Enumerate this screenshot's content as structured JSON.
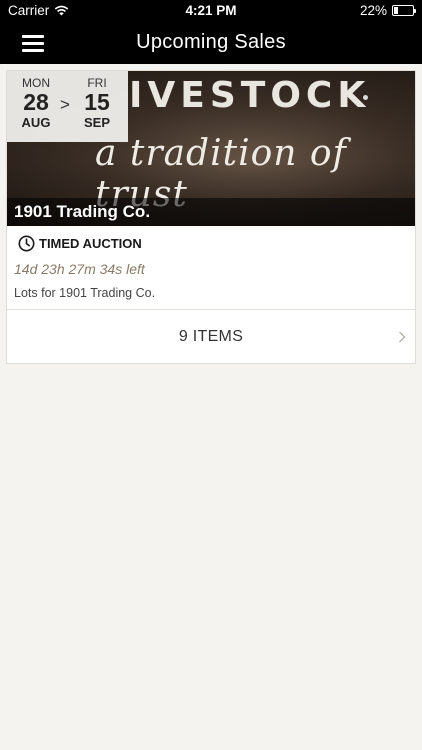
{
  "status_bar": {
    "carrier": "Carrier",
    "time": "4:21 PM",
    "battery_percent": "22%",
    "battery_level": 0.22,
    "wifi_icon": "wifi-icon",
    "battery_icon": "battery-icon"
  },
  "navbar": {
    "title": "Upcoming Sales",
    "menu_icon": "hamburger-menu-icon"
  },
  "sale": {
    "banner_word": "IVESTOCK",
    "banner_tagline": "a tradition of trust",
    "name": "1901 Trading Co.",
    "start": {
      "day": "MON",
      "date": "28",
      "month": "AUG"
    },
    "separator": ">",
    "end": {
      "day": "FRI",
      "date": "15",
      "month": "SEP"
    },
    "type": "TIMED AUCTION",
    "countdown": "14d 23h 27m 34s left",
    "lots_description": "Lots for 1901 Trading Co.",
    "items_label": "9 ITEMS"
  },
  "colors": {
    "header_bg": "#000000",
    "page_bg": "#f4f3ef",
    "countdown_text": "#8a7a66"
  }
}
